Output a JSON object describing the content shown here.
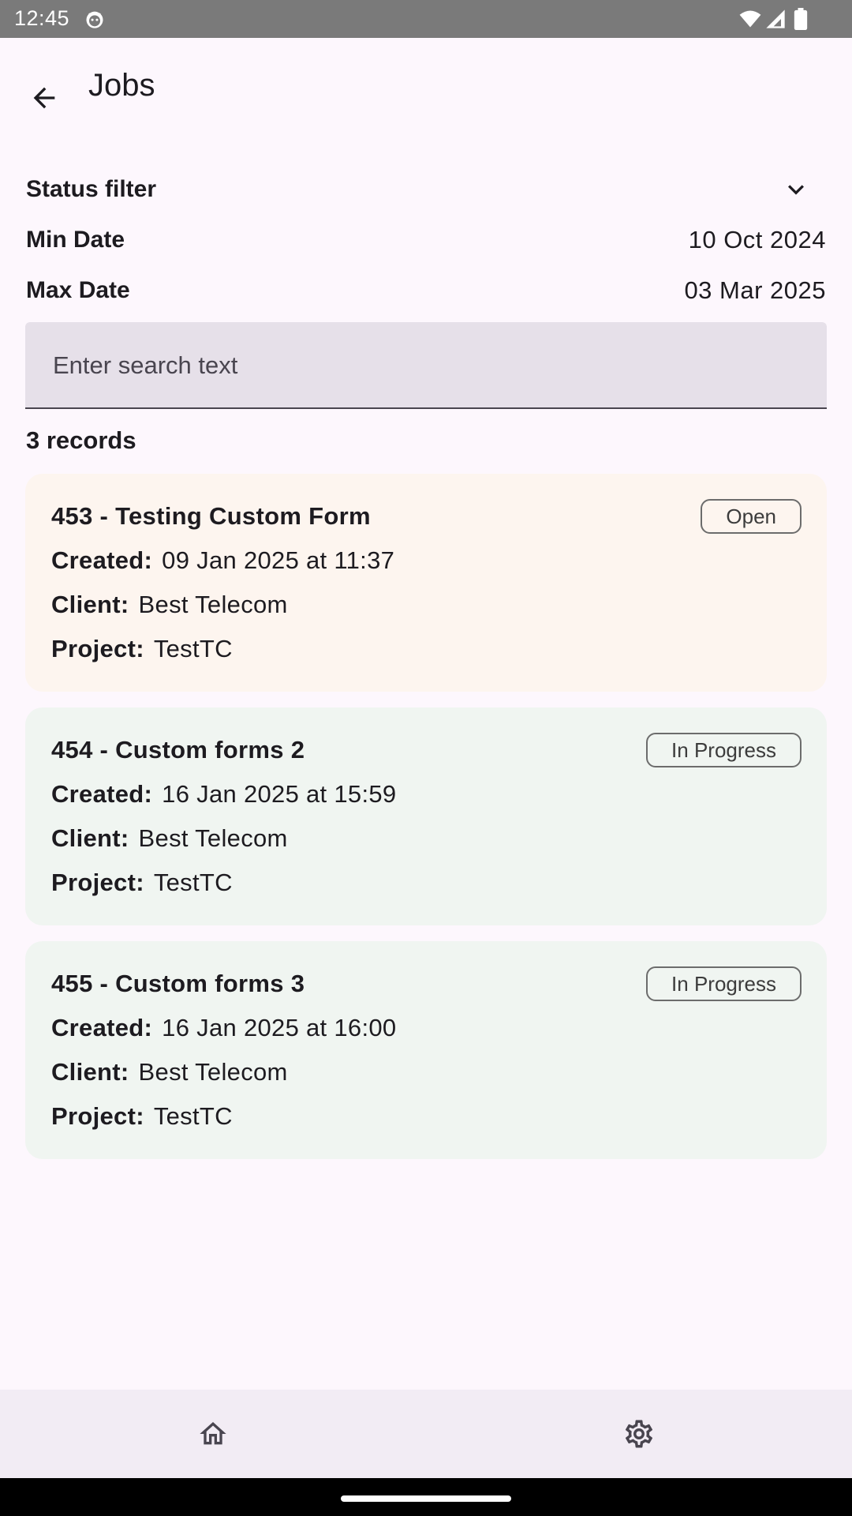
{
  "status_bar": {
    "time": "12:45"
  },
  "app_bar": {
    "title": "Jobs"
  },
  "filters": {
    "status_label": "Status filter",
    "min_date_label": "Min Date",
    "min_date_value": "10 Oct 2024",
    "max_date_label": "Max Date",
    "max_date_value": "03 Mar 2025"
  },
  "search": {
    "placeholder": "Enter search text",
    "value": ""
  },
  "records_count": "3 records",
  "labels": {
    "created": "Created:",
    "client": "Client:",
    "project": "Project:"
  },
  "jobs": [
    {
      "title": "453 - Testing Custom Form",
      "status": "Open",
      "created": "09 Jan 2025 at 11:37",
      "client": "Best Telecom",
      "project": "TestTC"
    },
    {
      "title": "454 - Custom forms 2",
      "status": "In Progress",
      "created": "16 Jan 2025 at 15:59",
      "client": "Best Telecom",
      "project": "TestTC"
    },
    {
      "title": "455 - Custom forms 3",
      "status": "In Progress",
      "created": "16 Jan 2025 at 16:00",
      "client": "Best Telecom",
      "project": "TestTC"
    }
  ],
  "bottom_nav": {
    "items": [
      {
        "icon": "home-icon"
      },
      {
        "icon": "gear-icon"
      }
    ]
  }
}
